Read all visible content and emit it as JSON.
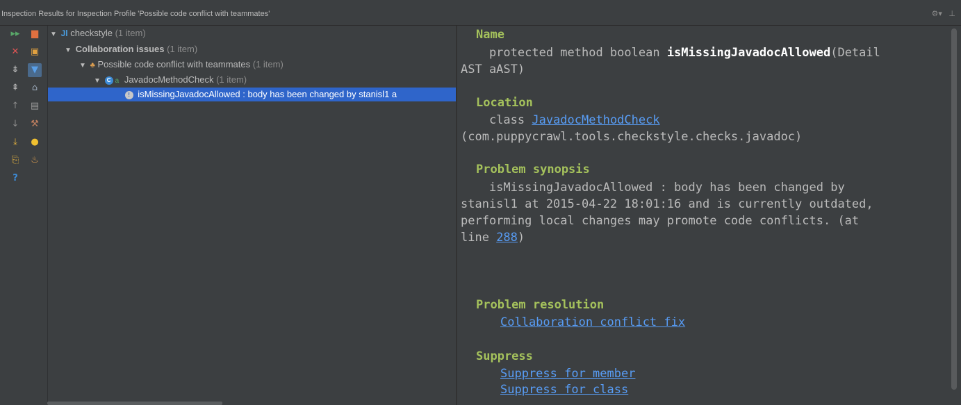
{
  "window": {
    "title": "Inspection Results for Inspection Profile 'Possible code conflict with teammates'",
    "icons": [
      "gear-icon",
      "hide-icon"
    ]
  },
  "toolbar": {
    "left": [
      "rerun-icon",
      "close-icon",
      "expand-all-icon",
      "collapse-all-icon",
      "prev-icon",
      "next-icon",
      "export-icon",
      "edit-settings-icon",
      "help-icon"
    ],
    "right": [
      "group-by-severity-icon",
      "group-by-directory-icon",
      "filter-icon",
      "lock-icon",
      "autoscroll-icon",
      "settings-icon",
      "quick-fix-icon",
      "suppress-icon"
    ]
  },
  "tree": {
    "root": {
      "label": "checkstyle",
      "count": "(1 item)"
    },
    "group": {
      "label": "Collaboration issues",
      "count": "(1 item)"
    },
    "inspection": {
      "label": "Possible code conflict with teammates",
      "count": "(1 item)"
    },
    "class": {
      "label": "JavadocMethodCheck",
      "count": "(1 item)"
    },
    "problem": {
      "label": "isMissingJavadocAllowed : body has been changed by stanisl1 a"
    }
  },
  "details": {
    "name_header": "Name",
    "name_prefix": "    protected method boolean ",
    "name_method": "isMissingJavadocAllowed",
    "name_suffix": "(Detail",
    "name_line2": "AST aAST)",
    "location_header": "Location",
    "location_prefix": "    class ",
    "location_class": "JavadocMethodCheck",
    "location_package": "(com.puppycrawl.tools.checkstyle.checks.javadoc)",
    "synopsis_header": "Problem synopsis",
    "synopsis_line1": "    isMissingJavadocAllowed : body has been changed by",
    "synopsis_line2": "stanisl1 at 2015-04-22 18:01:16 and is currently outdated,",
    "synopsis_line3": "performing local changes may promote code conflicts. (at",
    "synopsis_line4_prefix": "line ",
    "synopsis_line4_link": "288",
    "synopsis_line4_suffix": ")",
    "resolution_header": "Problem resolution",
    "resolution_link": "Collaboration conflict fix",
    "suppress_header": "Suppress",
    "suppress_member": "Suppress for member",
    "suppress_class": "Suppress for class"
  }
}
